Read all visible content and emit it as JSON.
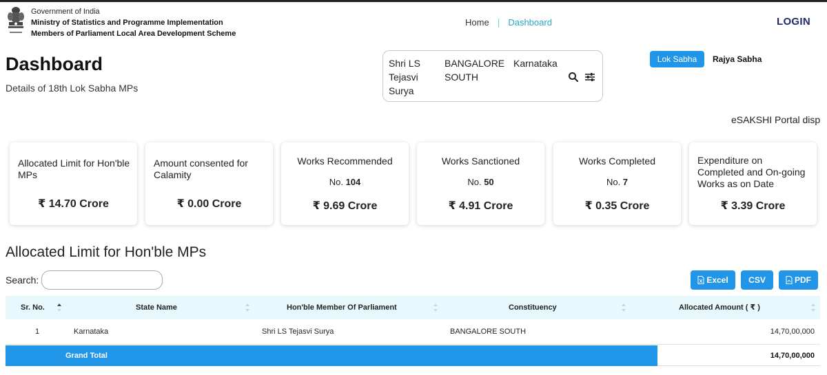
{
  "header": {
    "gov_line1": "Government of India",
    "gov_line2": "Ministry of Statistics and Programme Implementation",
    "gov_line3": "Members of Parliament Local Area Development Scheme",
    "emblem_icon": "national-emblem-icon",
    "nav": {
      "home": "Home",
      "separator": "|",
      "dashboard": "Dashboard"
    },
    "login": "LOGIN"
  },
  "page": {
    "title": "Dashboard",
    "subtitle": "Details of 18th Lok Sabha MPs"
  },
  "mp_selector": {
    "name": "Shri LS Tejasvi Surya",
    "constituency": "BANGALORE SOUTH",
    "state": "Karnataka",
    "search_icon": "search-icon",
    "filter_icon": "filter-sliders-icon"
  },
  "house_toggle": {
    "lok_sabha": "Lok Sabha",
    "rajya_sabha": "Rajya Sabha",
    "active": "Lok Sabha"
  },
  "marquee": "eSAKSHI Portal disp",
  "cards": [
    {
      "title": "Allocated Limit for Hon'ble MPs",
      "count_prefix": "",
      "count": "",
      "amount": "₹ 14.70 Crore"
    },
    {
      "title": "Amount consented for Calamity",
      "count_prefix": "",
      "count": "",
      "amount": "₹ 0.00 Crore"
    },
    {
      "title": "Works Recommended",
      "count_prefix": "No. ",
      "count": "104",
      "amount": "₹ 9.69 Crore"
    },
    {
      "title": "Works Sanctioned",
      "count_prefix": "No. ",
      "count": "50",
      "amount": "₹ 4.91 Crore"
    },
    {
      "title": "Works Completed",
      "count_prefix": "No. ",
      "count": "7",
      "amount": "₹ 0.35 Crore"
    },
    {
      "title": "Expenditure on Completed and On-going Works as on Date",
      "count_prefix": "",
      "count": "",
      "amount": "₹ 3.39 Crore"
    }
  ],
  "table_section": {
    "title": "Allocated Limit for Hon'ble MPs",
    "search_label": "Search:",
    "search_value": "",
    "buttons": {
      "excel": "Excel",
      "csv": "CSV",
      "pdf": "PDF"
    },
    "columns": [
      "Sr. No.",
      "State Name",
      "Hon'ble Member Of Parliament",
      "Constituency",
      "Allocated Amount ( ₹ )"
    ],
    "rows": [
      [
        "1",
        "Karnataka",
        "Shri LS Tejasvi Surya",
        "BANGALORE SOUTH",
        "14,70,00,000"
      ]
    ],
    "grand_total_label": "Grand Total",
    "grand_total_value": "14,70,00,000"
  },
  "colors": {
    "accent": "#2196e8",
    "nav_active": "#26a6c4",
    "login": "#1d2a6b",
    "table_header_bg": "#e7f9fc"
  }
}
